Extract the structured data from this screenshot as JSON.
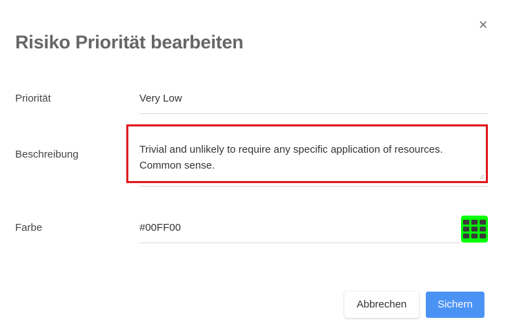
{
  "dialog": {
    "title": "Risiko Priorität bearbeiten",
    "close_icon": "close-icon"
  },
  "form": {
    "priority": {
      "label": "Priorität",
      "value": "Very Low"
    },
    "description": {
      "label": "Beschreibung",
      "value": "Trivial and unlikely to require any specific application of resources.\nCommon sense."
    },
    "color": {
      "label": "Farbe",
      "value": "#00FF00",
      "swatch_color": "#00ff00",
      "picker_icon": "grid-icon"
    }
  },
  "buttons": {
    "cancel_label": "Abbrechen",
    "save_label": "Sichern"
  },
  "colors": {
    "highlight_border": "#e0191f",
    "primary_button": "#4b92f5"
  }
}
